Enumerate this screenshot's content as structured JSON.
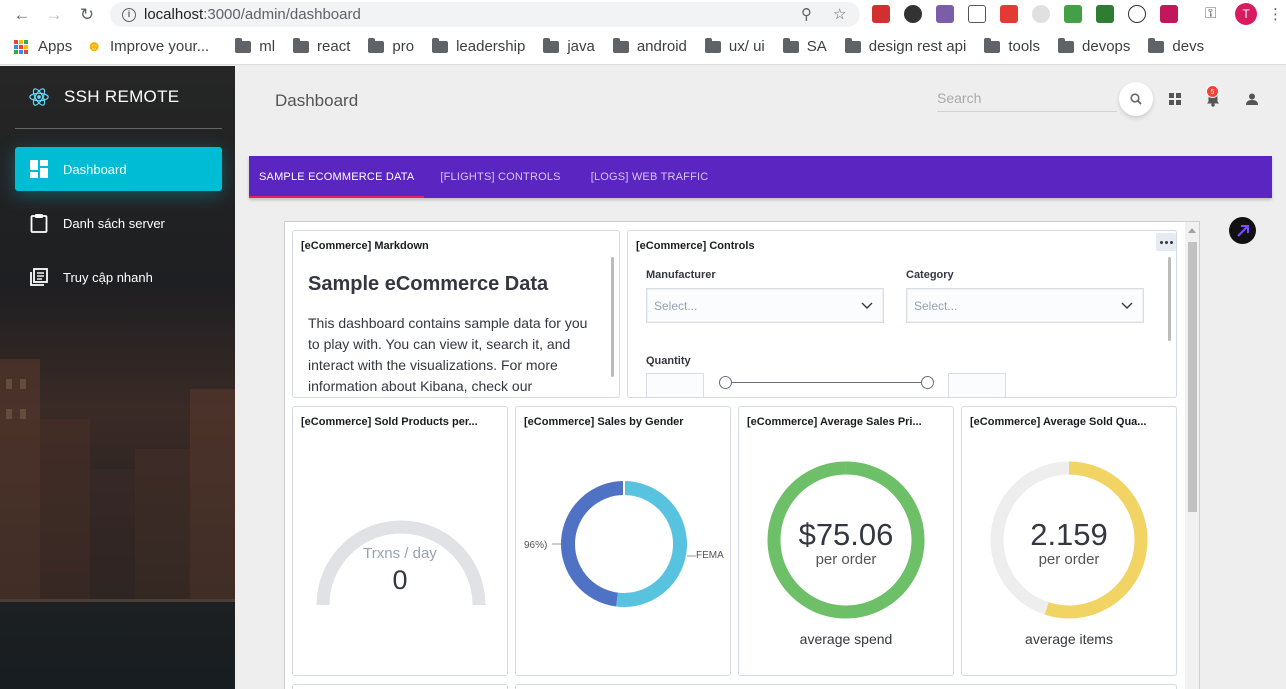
{
  "browser": {
    "url_host": "localhost",
    "url_path": ":3000/admin/dashboard",
    "avatar_letter": "T",
    "bookmarks": [
      "Apps",
      "Improve your...",
      "ml",
      "react",
      "pro",
      "leadership",
      "java",
      "android",
      "ux/ ui",
      "SA",
      "design rest api",
      "tools",
      "devops",
      "devs"
    ]
  },
  "sidebar": {
    "brand": "SSH REMOTE",
    "items": [
      {
        "label": "Dashboard",
        "icon": "dashboard-icon",
        "active": true
      },
      {
        "label": "Danh sách server",
        "icon": "clipboard-icon",
        "active": false
      },
      {
        "label": "Truy cập nhanh",
        "icon": "library-icon",
        "active": false
      }
    ]
  },
  "header": {
    "title": "Dashboard",
    "search_placeholder": "Search",
    "notification_count": "5"
  },
  "tabs": [
    {
      "label": "SAMPLE ECOMMERCE DATA",
      "active": true
    },
    {
      "label": "[FLIGHTS] CONTROLS",
      "active": false
    },
    {
      "label": "[LOGS] WEB TRAFFIC",
      "active": false
    }
  ],
  "kibana": {
    "markdown": {
      "title": "[eCommerce] Markdown",
      "heading": "Sample eCommerce Data",
      "body": "This dashboard contains sample data for you to play with. You can view it, search it, and interact with the visualizations. For more information about Kibana, check our"
    },
    "controls": {
      "title": "[eCommerce] Controls",
      "manufacturer_label": "Manufacturer",
      "manufacturer_placeholder": "Select...",
      "category_label": "Category",
      "category_placeholder": "Select...",
      "quantity_label": "Quantity"
    },
    "sold_products": {
      "title": "[eCommerce] Sold Products per...",
      "label": "Trxns / day",
      "value": "0"
    },
    "sales_gender": {
      "title": "[eCommerce] Sales by Gender",
      "left_label": "96%)",
      "right_label": "FEMA",
      "female_share": 0.52,
      "colors": {
        "female": "#57c3df",
        "male": "#4f72c4"
      }
    },
    "avg_sales_price": {
      "title": "[eCommerce] Average Sales Pri...",
      "value": "$75.06",
      "unit": "per order",
      "caption": "average spend",
      "fill": 1.0,
      "color": "#6dc067"
    },
    "avg_sold_qty": {
      "title": "[eCommerce] Average Sold Qua...",
      "value": "2.159",
      "unit": "per order",
      "caption": "average items",
      "fill": 0.55,
      "color": "#f1d464"
    }
  },
  "colors": {
    "accent_cyan": "#00bcd4",
    "tab_purple": "#5b25c2",
    "tab_indicator": "#e91e63",
    "badge_red": "#f44336"
  }
}
